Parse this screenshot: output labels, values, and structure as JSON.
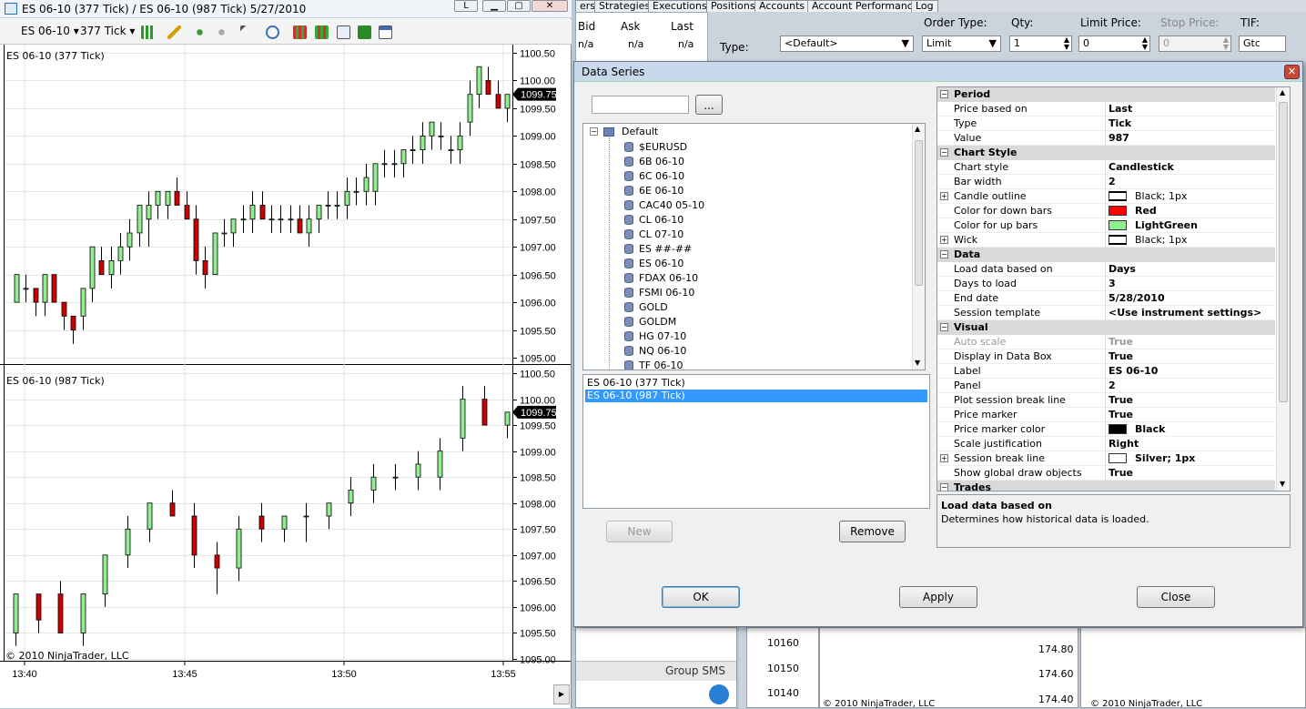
{
  "chart_window": {
    "title": "ES 06-10 (377 Tick) / ES 06-10 (987 Tick)  5/27/2010",
    "btn_l": "L",
    "toolbar": {
      "instrument": "ES 06-10",
      "interval": "377 Tick"
    },
    "copyright": "© 2010 NinjaTrader, LLC",
    "x_ticks": [
      "13:40",
      "13:45",
      "13:50",
      "13:55"
    ],
    "panel1": {
      "label": "ES 06-10 (377 Tick)",
      "price_marker": "1099.75",
      "y_ticks": [
        "1100.50",
        "1100.00",
        "1099.50",
        "1099.00",
        "1098.50",
        "1098.00",
        "1097.50",
        "1097.00",
        "1096.50",
        "1096.00",
        "1095.50",
        "1095.00"
      ]
    },
    "panel2": {
      "label": "ES 06-10 (987 Tick)",
      "price_marker": "1099.75",
      "y_ticks": [
        "1100.50",
        "1100.00",
        "1099.50",
        "1099.00",
        "1098.50",
        "1098.00",
        "1097.50",
        "1097.00",
        "1096.50",
        "1096.00",
        "1095.50",
        "1095.00"
      ]
    },
    "colors": {
      "up": "#90ee90",
      "down": "#cc0000",
      "outline": "#000000"
    }
  },
  "chart_data": [
    {
      "type": "candlestick",
      "title": "ES 06-10 (377 Tick)",
      "ylim": [
        1095.0,
        1100.5
      ],
      "ohlc": [
        [
          1096.0,
          1096.5,
          1096.0,
          1096.5
        ],
        [
          1096.25,
          1096.5,
          1096.0,
          1096.25
        ],
        [
          1096.25,
          1096.25,
          1095.75,
          1096.0
        ],
        [
          1096.0,
          1096.5,
          1095.75,
          1096.5
        ],
        [
          1096.5,
          1096.5,
          1096.0,
          1096.0
        ],
        [
          1096.0,
          1096.0,
          1095.5,
          1095.75
        ],
        [
          1095.75,
          1095.75,
          1095.25,
          1095.5
        ],
        [
          1095.75,
          1096.25,
          1095.5,
          1096.25
        ],
        [
          1096.25,
          1097.0,
          1096.0,
          1097.0
        ],
        [
          1096.75,
          1097.0,
          1096.5,
          1096.5
        ],
        [
          1096.5,
          1097.0,
          1096.25,
          1096.75
        ],
        [
          1096.75,
          1097.25,
          1096.5,
          1097.0
        ],
        [
          1097.0,
          1097.5,
          1096.75,
          1097.25
        ],
        [
          1097.25,
          1097.75,
          1097.0,
          1097.75
        ],
        [
          1097.5,
          1098.0,
          1097.0,
          1097.75
        ],
        [
          1097.75,
          1098.0,
          1097.5,
          1098.0
        ],
        [
          1097.75,
          1098.0,
          1097.5,
          1098.0
        ],
        [
          1098.0,
          1098.25,
          1097.75,
          1097.75
        ],
        [
          1097.75,
          1098.0,
          1097.5,
          1097.5
        ],
        [
          1097.5,
          1097.75,
          1096.5,
          1096.75
        ],
        [
          1096.75,
          1097.0,
          1096.25,
          1096.5
        ],
        [
          1096.5,
          1097.25,
          1096.5,
          1097.25
        ],
        [
          1097.25,
          1097.5,
          1097.0,
          1097.25
        ],
        [
          1097.25,
          1097.5,
          1097.0,
          1097.5
        ],
        [
          1097.5,
          1097.75,
          1097.25,
          1097.5
        ],
        [
          1097.5,
          1098.0,
          1097.25,
          1097.75
        ],
        [
          1097.75,
          1098.0,
          1097.5,
          1097.5
        ],
        [
          1097.5,
          1097.75,
          1097.25,
          1097.5
        ],
        [
          1097.5,
          1097.75,
          1097.25,
          1097.5
        ],
        [
          1097.5,
          1097.75,
          1097.25,
          1097.5
        ],
        [
          1097.5,
          1097.75,
          1097.25,
          1097.25
        ],
        [
          1097.25,
          1097.75,
          1097.0,
          1097.5
        ],
        [
          1097.5,
          1097.75,
          1097.25,
          1097.75
        ],
        [
          1097.75,
          1098.0,
          1097.5,
          1097.75
        ],
        [
          1097.75,
          1098.0,
          1097.5,
          1097.75
        ],
        [
          1097.75,
          1098.25,
          1097.5,
          1098.0
        ],
        [
          1098.0,
          1098.25,
          1097.75,
          1098.0
        ],
        [
          1098.0,
          1098.5,
          1097.75,
          1098.25
        ],
        [
          1098.0,
          1098.5,
          1097.75,
          1098.5
        ],
        [
          1098.5,
          1098.75,
          1098.25,
          1098.5
        ],
        [
          1098.5,
          1098.75,
          1098.25,
          1098.5
        ],
        [
          1098.5,
          1098.75,
          1098.25,
          1098.75
        ],
        [
          1098.75,
          1099.0,
          1098.5,
          1098.75
        ],
        [
          1098.75,
          1099.25,
          1098.5,
          1099.0
        ],
        [
          1099.0,
          1099.25,
          1098.75,
          1099.25
        ],
        [
          1099.0,
          1099.25,
          1098.75,
          1099.0
        ],
        [
          1098.75,
          1099.0,
          1098.5,
          1098.75
        ],
        [
          1098.75,
          1099.25,
          1098.5,
          1099.0
        ],
        [
          1099.25,
          1100.0,
          1099.0,
          1099.75
        ],
        [
          1099.75,
          1100.25,
          1099.5,
          1100.25
        ],
        [
          1100.0,
          1100.25,
          1099.75,
          1099.75
        ],
        [
          1099.75,
          1100.0,
          1099.5,
          1099.5
        ],
        [
          1099.5,
          1099.75,
          1099.25,
          1099.75
        ]
      ]
    },
    {
      "type": "candlestick",
      "title": "ES 06-10 (987 Tick)",
      "ylim": [
        1095.0,
        1100.5
      ],
      "ohlc": [
        [
          1095.5,
          1096.25,
          1095.25,
          1096.25
        ],
        [
          1096.25,
          1096.25,
          1095.5,
          1095.75
        ],
        [
          1096.25,
          1096.5,
          1095.5,
          1095.5
        ],
        [
          1095.5,
          1096.25,
          1095.25,
          1096.25
        ],
        [
          1096.25,
          1097.0,
          1096.0,
          1097.0
        ],
        [
          1097.0,
          1097.75,
          1096.75,
          1097.5
        ],
        [
          1097.5,
          1098.0,
          1097.25,
          1098.0
        ],
        [
          1098.0,
          1098.25,
          1097.75,
          1097.75
        ],
        [
          1097.75,
          1098.0,
          1096.75,
          1097.0
        ],
        [
          1097.0,
          1097.25,
          1096.25,
          1096.75
        ],
        [
          1096.75,
          1097.75,
          1096.5,
          1097.5
        ],
        [
          1097.75,
          1098.0,
          1097.25,
          1097.5
        ],
        [
          1097.5,
          1097.75,
          1097.25,
          1097.75
        ],
        [
          1097.75,
          1098.0,
          1097.25,
          1097.75
        ],
        [
          1097.75,
          1098.0,
          1097.5,
          1098.0
        ],
        [
          1098.0,
          1098.5,
          1097.75,
          1098.25
        ],
        [
          1098.25,
          1098.75,
          1098.0,
          1098.5
        ],
        [
          1098.5,
          1098.75,
          1098.25,
          1098.5
        ],
        [
          1098.5,
          1099.0,
          1098.25,
          1098.75
        ],
        [
          1098.5,
          1099.25,
          1098.25,
          1099.0
        ],
        [
          1099.25,
          1100.25,
          1099.0,
          1100.0
        ],
        [
          1100.0,
          1100.25,
          1099.5,
          1099.5
        ],
        [
          1099.5,
          1099.75,
          1099.25,
          1099.75
        ]
      ]
    }
  ],
  "back_window": {
    "tabs": [
      "ers",
      "Strategies",
      "Executions",
      "Positions",
      "Accounts",
      "Account Performance",
      "Log"
    ],
    "quote_headers": [
      "Bid",
      "Ask",
      "Last"
    ],
    "quote_values": [
      "n/a",
      "n/a",
      "n/a"
    ],
    "order_headers": {
      "order_type": "Order Type:",
      "qty": "Qty:",
      "limit_price": "Limit Price:",
      "stop_price": "Stop Price:",
      "tif": "TIF:"
    },
    "type_label": "Type:",
    "type_value": "<Default>",
    "order_type_value": "Limit",
    "qty_value": "1",
    "limit_value": "0",
    "stop_value": "0",
    "tif_value": "Gtc",
    "group_sms": "Group SMS",
    "bottom_prices_a": [
      "10160",
      "10150",
      "10140"
    ],
    "bottom_prices_b": [
      "174.80",
      "174.60",
      "174.40"
    ],
    "bottom_copyright": "© 2010 NinjaTrader, LLC"
  },
  "dialog": {
    "title": "Data Series",
    "browse_label": "...",
    "search_value": "",
    "tree_root": "Default",
    "instruments": [
      "$EURUSD",
      "6B 06-10",
      "6C 06-10",
      "6E 06-10",
      "CAC40 05-10",
      "CL 06-10",
      "CL 07-10",
      "ES ##-##",
      "ES 06-10",
      "FDAX 06-10",
      "FSMI 06-10",
      "GOLD",
      "GOLDM",
      "HG 07-10",
      "NQ 06-10",
      "TF 06-10"
    ],
    "series": [
      "ES 06-10 (377 Tick)",
      "ES 06-10 (987 Tick)"
    ],
    "selected_series": 1,
    "new_label": "New",
    "remove_label": "Remove",
    "ok_label": "OK",
    "apply_label": "Apply",
    "close_label": "Close",
    "desc_title": "Load data based on",
    "desc_text": "Determines how historical data is loaded.",
    "props": [
      {
        "cat": "Period"
      },
      {
        "k": "Price based on",
        "v": "Last"
      },
      {
        "k": "Type",
        "v": "Tick"
      },
      {
        "k": "Value",
        "v": "987"
      },
      {
        "cat": "Chart Style"
      },
      {
        "k": "Chart style",
        "v": "Candlestick"
      },
      {
        "k": "Bar width",
        "v": "2"
      },
      {
        "k": "Candle outline",
        "v": "Black; 1px",
        "swatch": "#ffffff",
        "exp": true,
        "light": true
      },
      {
        "k": "Color for down bars",
        "v": "Red",
        "swatch": "#ff0000"
      },
      {
        "k": "Color for up bars",
        "v": "LightGreen",
        "swatch": "#90ee90"
      },
      {
        "k": "Wick",
        "v": "Black; 1px",
        "swatch": "#ffffff",
        "exp": true,
        "light": true
      },
      {
        "cat": "Data"
      },
      {
        "k": "Load data based on",
        "v": "Days",
        "sel": true
      },
      {
        "k": "Days to load",
        "v": "3"
      },
      {
        "k": "End date",
        "v": "5/28/2010"
      },
      {
        "k": "Session template",
        "v": "<Use instrument settings>"
      },
      {
        "cat": "Visual"
      },
      {
        "k": "Auto scale",
        "v": "True",
        "disabled": true
      },
      {
        "k": "Display in Data Box",
        "v": "True"
      },
      {
        "k": "Label",
        "v": "ES 06-10"
      },
      {
        "k": "Panel",
        "v": "2"
      },
      {
        "k": "Plot session break line",
        "v": "True"
      },
      {
        "k": "Price marker",
        "v": "True"
      },
      {
        "k": "Price marker color",
        "v": "Black",
        "swatch": "#000000"
      },
      {
        "k": "Scale justification",
        "v": "Right"
      },
      {
        "k": "Session break line",
        "v": "Silver; 1px",
        "swatch": "#ffffff",
        "exp": true
      },
      {
        "k": "Show global draw objects",
        "v": "True"
      },
      {
        "cat": "Trades"
      }
    ]
  }
}
